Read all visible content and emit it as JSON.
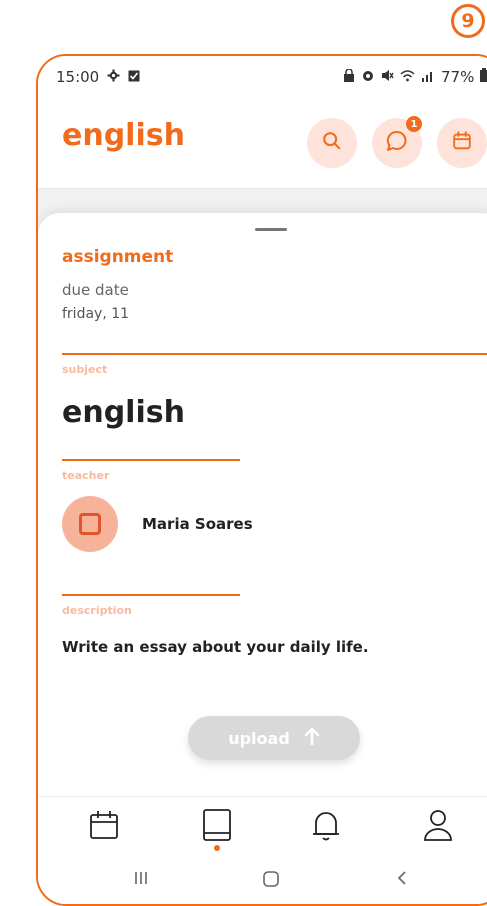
{
  "badge": {
    "number": "9"
  },
  "status_bar": {
    "time": "15:00",
    "battery": "77%"
  },
  "app_bar": {
    "title": "english",
    "notification_count": "1"
  },
  "assignment": {
    "heading": "assignment",
    "due_label": "due date",
    "due_value": "friday, 11",
    "subject_label": "subject",
    "subject_value": "english",
    "teacher_label": "teacher",
    "teacher_name": "Maria Soares",
    "description_label": "description",
    "description_text": "Write an essay about your daily life.",
    "upload_label": "upload"
  },
  "bottom_nav": {
    "items": [
      "calendar-icon",
      "book-icon",
      "bell-icon",
      "profile-icon"
    ],
    "active": "book-icon"
  },
  "system_nav": {
    "items": [
      "recent-apps-icon",
      "home-icon",
      "back-icon"
    ]
  },
  "colors": {
    "accent": "#f26a1b",
    "accent_soft": "#fde3da",
    "label_soft": "#f7b9a2"
  }
}
